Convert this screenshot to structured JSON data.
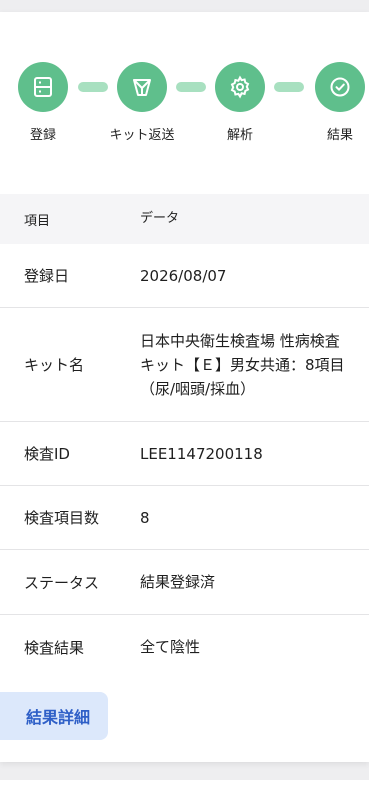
{
  "steps": [
    {
      "label": "登録",
      "icon": "register-icon"
    },
    {
      "label": "キット返送",
      "icon": "return-kit-icon"
    },
    {
      "label": "解析",
      "icon": "gear-icon"
    },
    {
      "label": "結果",
      "icon": "check-circle-icon"
    }
  ],
  "colors": {
    "step": "#5fbf8c",
    "connector": "#a8e0c0",
    "button_bg": "#dce8fb",
    "button_text": "#2e5fc7"
  },
  "table": {
    "header": {
      "key": "項目",
      "value": "データ"
    },
    "rows": [
      {
        "key": "登録日",
        "value": "2026/08/07"
      },
      {
        "key": "キット名",
        "value": "日本中央衛生検査場 性病検査キット【Ｅ】男女共通：8項目（尿/咽頭/採血）"
      },
      {
        "key": "検査ID",
        "value": "LEE1147200118"
      },
      {
        "key": "検査項目数",
        "value": "8"
      },
      {
        "key": "ステータス",
        "value": "結果登録済"
      },
      {
        "key": "検査結果",
        "value": "全て陰性"
      }
    ]
  },
  "detail_button": {
    "label": "結果詳細"
  }
}
